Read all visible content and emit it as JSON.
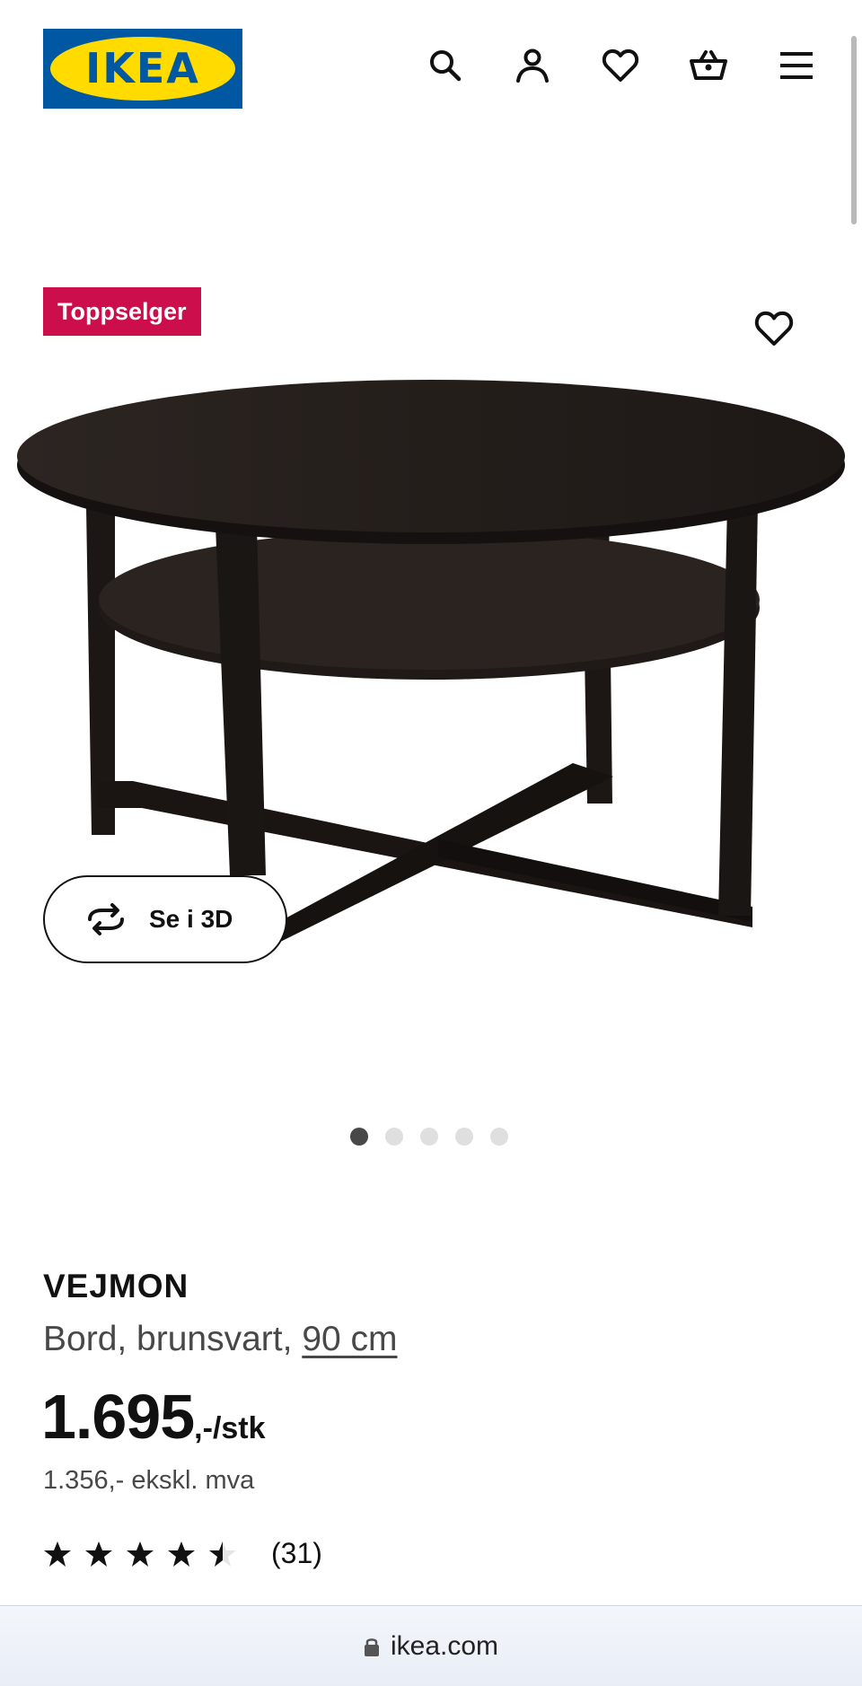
{
  "header": {
    "logo_text": "IKEA",
    "icons": [
      "search-icon",
      "account-icon",
      "favourites-icon",
      "basket-icon",
      "menu-icon"
    ]
  },
  "product": {
    "badge": "Toppselger",
    "view_3d_label": "Se i 3D",
    "name": "VEJMON",
    "description": "Bord, brunsvart,",
    "size": "90 cm",
    "price": "1.695",
    "price_unit": ",-/stk",
    "price_ex_vat": "1.356,- ekskl. mva",
    "rating": 4.5,
    "review_count": "(31)"
  },
  "gallery": {
    "image_count": 5,
    "active_index": 0
  },
  "browser": {
    "url": "ikea.com"
  },
  "colors": {
    "badge": "#cc0e4d",
    "ikea_blue": "#0058a3",
    "ikea_yellow": "#ffdb00"
  }
}
